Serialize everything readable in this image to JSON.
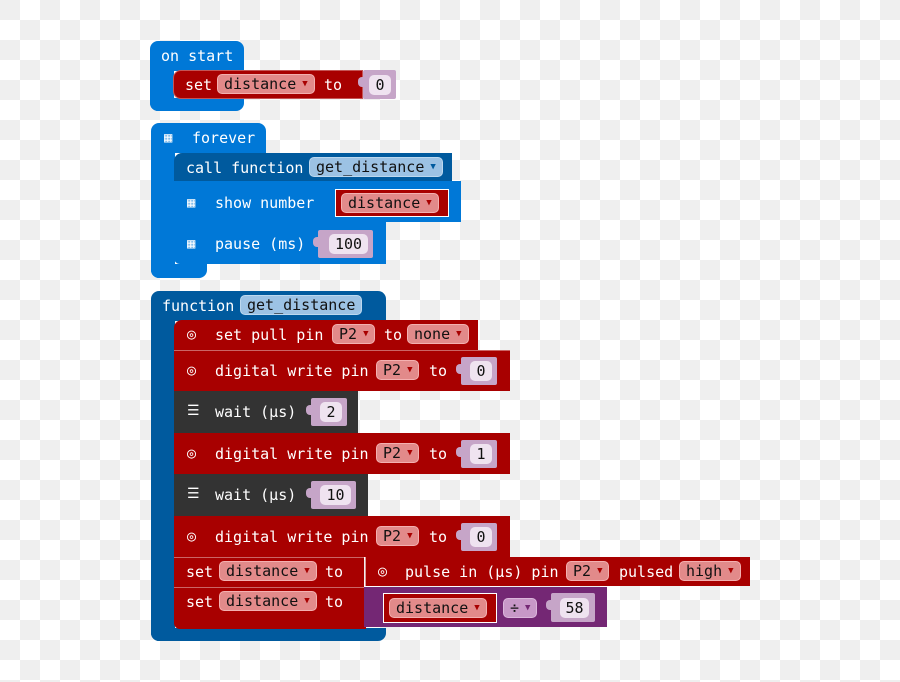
{
  "colors": {
    "events_blue": "#0078d7",
    "functions_blue": "#005a9e",
    "pins_red": "#a80000",
    "control_dark": "#333333",
    "math_purple": "#742774",
    "checker_light": "#efefef"
  },
  "on_start": {
    "label": "on start",
    "set_block": {
      "set": "set",
      "variable": "distance",
      "to": "to",
      "value": "0"
    }
  },
  "forever": {
    "icon": "grid-icon",
    "label": "forever",
    "call": {
      "label": "call function",
      "name": "get_distance"
    },
    "show_number": {
      "label": "show number",
      "variable": "distance"
    },
    "pause": {
      "label": "pause (ms)",
      "value": "100"
    }
  },
  "function_def": {
    "label": "function",
    "name": "get_distance",
    "blocks": {
      "set_pull": {
        "label": "set pull pin",
        "pin": "P2",
        "to": "to",
        "mode": "none"
      },
      "dw1": {
        "label": "digital write pin",
        "pin": "P2",
        "to": "to",
        "value": "0"
      },
      "wait1": {
        "label": "wait (µs)",
        "value": "2"
      },
      "dw2": {
        "label": "digital write pin",
        "pin": "P2",
        "to": "to",
        "value": "1"
      },
      "wait2": {
        "label": "wait (µs)",
        "value": "10"
      },
      "dw3": {
        "label": "digital write pin",
        "pin": "P2",
        "to": "to",
        "value": "0"
      },
      "set1": {
        "set": "set",
        "variable": "distance",
        "to": "to",
        "pulse": {
          "label": "pulse in (µs) pin",
          "pin": "P2",
          "pulsed": "pulsed",
          "level": "high"
        }
      },
      "set2": {
        "set": "set",
        "variable": "distance",
        "to": "to",
        "math": {
          "variable": "distance",
          "operator": "÷",
          "value": "58"
        }
      }
    }
  },
  "dropdown_arrow": "▼"
}
